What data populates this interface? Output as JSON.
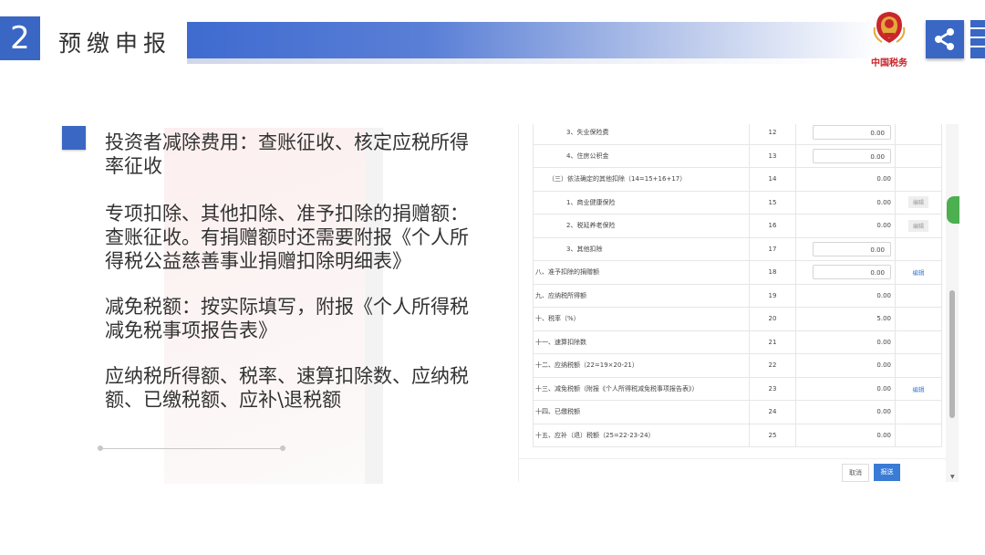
{
  "header": {
    "number": "2",
    "title": "预缴申报",
    "logo_text": "中国税务",
    "logo_icon": "tax-emblem-icon",
    "share_icon": "share-icon",
    "colors": {
      "accent": "#3a67c4"
    }
  },
  "content": {
    "para1": "投资者减除费用：查账征收、核定应税所得率征收",
    "para2": "专项扣除、其他扣除、准予扣除的捐赠额：查账征收。有捐赠额时还需要附报《个人所得税公益慈善事业捐赠扣除明细表》",
    "para3": "减免税额：按实际填写，附报《个人所得税减免税事项报告表》",
    "para4": "应纳税所得额、税率、速算扣除数、应纳税额、已缴税额、应补\\退税额"
  },
  "form": {
    "rows": [
      {
        "label": "3、失业保险费",
        "no": "12",
        "value": "0.00",
        "input": true,
        "action": ""
      },
      {
        "label": "4、住房公积金",
        "no": "13",
        "value": "0.00",
        "input": true,
        "action": ""
      },
      {
        "label": "（三）依法确定的其他扣除（14=15+16+17）",
        "no": "14",
        "value": "0.00",
        "input": false,
        "action": ""
      },
      {
        "label": "1、商业健康保险",
        "no": "15",
        "value": "0.00",
        "input": false,
        "action": "编辑",
        "action_style": "gray"
      },
      {
        "label": "2、税延养老保险",
        "no": "16",
        "value": "0.00",
        "input": false,
        "action": "编辑",
        "action_style": "gray"
      },
      {
        "label": "3、其他扣除",
        "no": "17",
        "value": "0.00",
        "input": true,
        "action": ""
      },
      {
        "label": "八、准予扣除的捐赠额",
        "no": "18",
        "value": "0.00",
        "input": true,
        "action": "编辑",
        "action_style": "blue"
      },
      {
        "label": "九、应纳税所得额",
        "no": "19",
        "value": "0.00",
        "input": false,
        "action": ""
      },
      {
        "label": "十、税率（%）",
        "no": "20",
        "value": "5.00",
        "input": false,
        "action": ""
      },
      {
        "label": "十一、速算扣除数",
        "no": "21",
        "value": "0.00",
        "input": false,
        "action": ""
      },
      {
        "label": "十二、应纳税额（22=19×20-21）",
        "no": "22",
        "value": "0.00",
        "input": false,
        "action": ""
      },
      {
        "label": "十三、减免税额（附报《个人所得税减免税事项报告表》）",
        "no": "23",
        "value": "0.00",
        "input": false,
        "action": "编辑",
        "action_style": "blue"
      },
      {
        "label": "十四、已缴税额",
        "no": "24",
        "value": "0.00",
        "input": false,
        "action": ""
      },
      {
        "label": "十五、应补（退）税额（25=22-23-24）",
        "no": "25",
        "value": "0.00",
        "input": false,
        "action": ""
      }
    ],
    "cancel_label": "取消",
    "submit_label": "报送"
  }
}
